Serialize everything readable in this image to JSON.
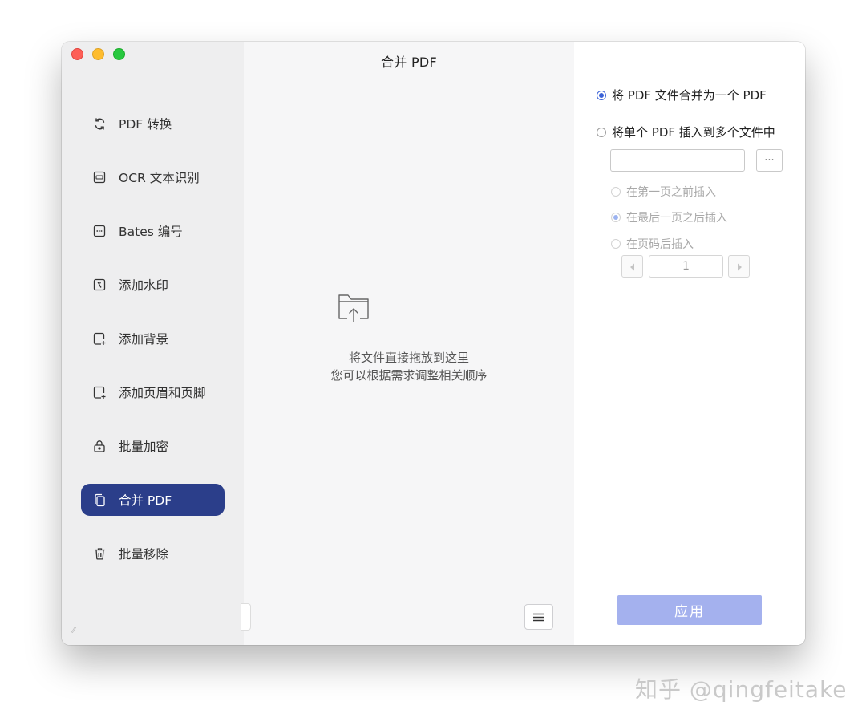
{
  "window": {
    "title": "合并 PDF"
  },
  "sidebar": {
    "items": [
      {
        "label": "PDF 转换",
        "icon": "convert-icon"
      },
      {
        "label": "OCR 文本识别",
        "icon": "ocr-icon"
      },
      {
        "label": "Bates 编号",
        "icon": "bates-icon"
      },
      {
        "label": "添加水印",
        "icon": "watermark-icon"
      },
      {
        "label": "添加背景",
        "icon": "background-icon"
      },
      {
        "label": "添加页眉和页脚",
        "icon": "header-footer-icon"
      },
      {
        "label": "批量加密",
        "icon": "lock-icon"
      },
      {
        "label": "合并 PDF",
        "icon": "merge-icon",
        "active": true
      },
      {
        "label": "批量移除",
        "icon": "trash-icon"
      }
    ]
  },
  "main": {
    "drop_line1": "将文件直接拖放到这里",
    "drop_line2": "您可以根据需求调整相关顺序"
  },
  "options": {
    "merge_one": "将 PDF 文件合并为一个 PDF",
    "insert_multi": "将单个 PDF 插入到多个文件中",
    "path_value": "",
    "browse_label": "···",
    "insert_before_first": "在第一页之前插入",
    "insert_after_last": "在最后一页之后插入",
    "insert_after_page": "在页码后插入",
    "page_number": "1",
    "selected": "merge_one",
    "position_selected": "insert_after_last"
  },
  "apply_label": "应用",
  "watermark_text": "知乎 @qingfeitake",
  "colors": {
    "accent": "#2b3e8a",
    "apply": "#a4b1ee",
    "radio": "#3a62d8"
  }
}
